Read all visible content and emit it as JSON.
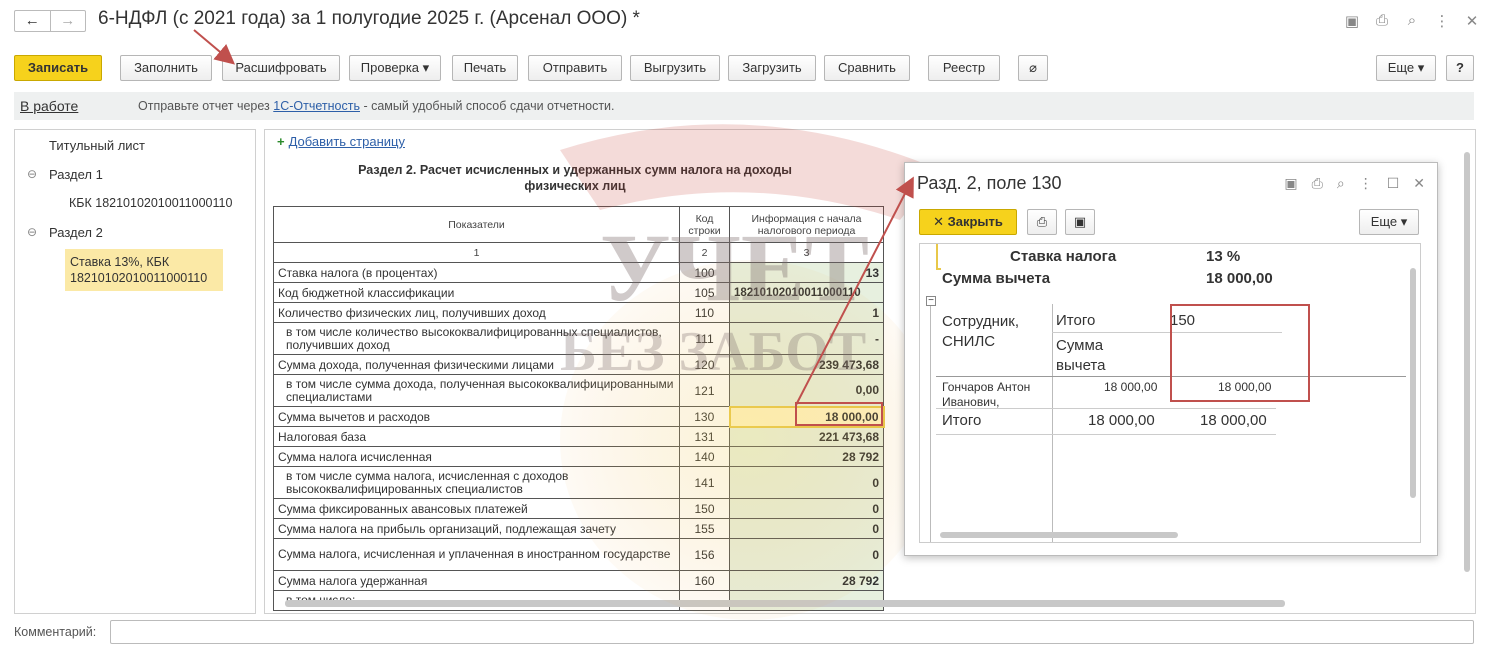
{
  "window": {
    "title": "6-НДФЛ (с 2021 года) за 1 полугодие 2025 г. (Арсенал ООО) *",
    "back": "←",
    "forward": "→"
  },
  "toolbar": {
    "save": "Записать",
    "fill": "Заполнить",
    "decode": "Расшифровать",
    "check": "Проверка",
    "print": "Печать",
    "send": "Отправить",
    "export": "Выгрузить",
    "import": "Загрузить",
    "compare": "Сравнить",
    "registry": "Реестр",
    "more": "Еще",
    "help": "?"
  },
  "infobar": {
    "status": "В работе",
    "msg_before": "Отправьте отчет через ",
    "msg_link": "1С-Отчетность",
    "msg_after": " - самый удобный способ сдачи отчетности."
  },
  "tree": {
    "items": [
      "Титульный лист",
      "Раздел 1",
      "КБК 18210102010011000110",
      "Раздел 2"
    ],
    "selected": "Ставка 13%, КБК 18210102010011000110"
  },
  "doc": {
    "add_page": "Добавить страницу",
    "title_line1": "Раздел 2. Расчет исчисленных и удержанных сумм налога на доходы",
    "title_line2": "физических лиц",
    "headers": [
      "Показатели",
      "Код строки",
      "Информация с начала налогового периода"
    ],
    "col_nums": [
      "1",
      "2",
      "3"
    ],
    "rows": [
      {
        "label": "Ставка налога (в процентах)",
        "code": "100",
        "value": "13"
      },
      {
        "label": "Код бюджетной классификации",
        "code": "105",
        "value": "18210102010011000110"
      },
      {
        "label": "Количество физических лиц, получивших доход",
        "code": "110",
        "value": "1"
      },
      {
        "label": "в том числе количество высококвалифицированных специалистов, получивших доход",
        "code": "111",
        "value": "-"
      },
      {
        "label": "Сумма дохода, полученная физическими лицами",
        "code": "120",
        "value": "239 473,68"
      },
      {
        "label": "в том числе сумма дохода, полученная высококвалифицированными специалистами",
        "code": "121",
        "value": "0,00"
      },
      {
        "label": "Сумма вычетов и расходов",
        "code": "130",
        "value": "18 000,00"
      },
      {
        "label": "Налоговая база",
        "code": "131",
        "value": "221 473,68"
      },
      {
        "label": "Сумма налога исчисленная",
        "code": "140",
        "value": "28 792"
      },
      {
        "label": "в том числе сумма налога, исчисленная с доходов высококвалифицированных специалистов",
        "code": "141",
        "value": "0"
      },
      {
        "label": "Сумма фиксированных авансовых платежей",
        "code": "150",
        "value": "0"
      },
      {
        "label": "Сумма налога на прибыль организаций, подлежащая зачету",
        "code": "155",
        "value": "0"
      },
      {
        "label": "Сумма налога, исчисленная и уплаченная в иностранном государстве",
        "code": "156",
        "value": "0"
      },
      {
        "label": "Сумма налога удержанная",
        "code": "160",
        "value": "28 792"
      },
      {
        "label": "в том числе:",
        "code": "",
        "value": ""
      }
    ]
  },
  "popup": {
    "title": "Разд. 2, поле 130",
    "close": "Закрыть",
    "more": "Еще",
    "rate_label": "Ставка налога",
    "rate_value": "13 %",
    "deduction_label": "Сумма вычета",
    "deduction_value": "18 000,00",
    "col_employee": "Сотрудник, СНИЛС",
    "col_total": "Итого",
    "col_deduction": "Сумма вычета",
    "col_code": "150",
    "employee_name": "Гончаров Антон Иванович,",
    "employee_total": "18 000,00",
    "employee_code_value": "18 000,00",
    "footer_label": "Итого",
    "footer_total": "18 000,00",
    "footer_code_value": "18 000,00"
  },
  "comment": {
    "label": "Комментарий:"
  },
  "watermark": {
    "line1": "УЧЕТ",
    "line2": "БЕЗ ЗАБОТ"
  },
  "colors": {
    "primary_button": "#f6d21c",
    "link": "#2d5fa8",
    "selection": "#fbe9a6",
    "annotation_red": "#c0504d"
  }
}
